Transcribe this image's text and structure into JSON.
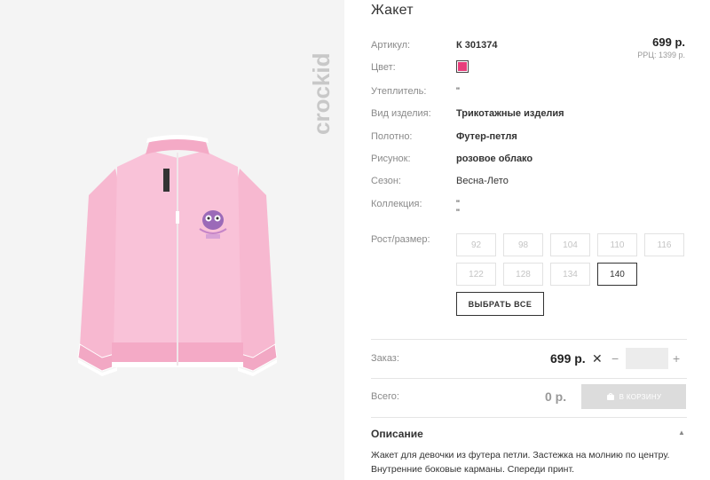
{
  "product": {
    "title": "Жакет",
    "brand": "crockid",
    "price": "699 р.",
    "rrp": "PPЦ: 1399 р.",
    "color_hex": "#e83e7b",
    "attributes": [
      {
        "label": "Артикул:",
        "value": "К 301374"
      },
      {
        "label": "Цвет:",
        "value": ""
      },
      {
        "label": "Утеплитель:",
        "value": "\""
      },
      {
        "label": "Вид изделия:",
        "value": "Трикотажные изделия"
      },
      {
        "label": "Полотно:",
        "value": "Футер-петля"
      },
      {
        "label": "Рисунок:",
        "value": "розовое облако"
      },
      {
        "label": "Сезон:",
        "value": "Весна-Лето"
      },
      {
        "label": "Коллекция:",
        "value": "\""
      }
    ],
    "collection_extra": "\""
  },
  "sizes": {
    "label": "Рост/размер:",
    "options": [
      "92",
      "98",
      "104",
      "110",
      "116",
      "122",
      "128",
      "134",
      "140"
    ],
    "selected": "140",
    "select_all_label": "ВЫБРАТЬ ВСЕ"
  },
  "order": {
    "label": "Заказ:",
    "price": "699 р.",
    "times": "✕",
    "minus": "−",
    "plus": "+",
    "quantity": ""
  },
  "total": {
    "label": "Всего:",
    "value": "0 р.",
    "cart_button": "В КОРЗИНУ"
  },
  "description": {
    "title": "Описание",
    "toggle": "▲",
    "text": "Жакет для девочки из футера петли. Застежка на молнию по центру. Внутренние боковые карманы. Спереди принт."
  }
}
